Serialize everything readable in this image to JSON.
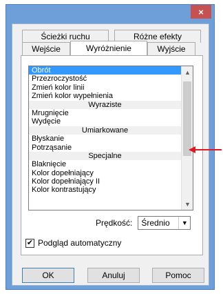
{
  "window": {
    "close_glyph": "×"
  },
  "tabs_back": [
    "Ścieżki ruchu",
    "Różne efekty"
  ],
  "tabs_front": [
    "Wejście",
    "Wyróżnienie",
    "Wyjście"
  ],
  "selected_tab": "Wyróżnienie",
  "list": [
    {
      "type": "item",
      "label": "Obrót",
      "selected": true
    },
    {
      "type": "item",
      "label": "Przezroczystość"
    },
    {
      "type": "item",
      "label": "Zmień kolor linii"
    },
    {
      "type": "item",
      "label": "Zmień kolor wypełnienia"
    },
    {
      "type": "header",
      "label": "Wyraziste"
    },
    {
      "type": "item",
      "label": "Mrugnięcie"
    },
    {
      "type": "item",
      "label": "Wydęcie"
    },
    {
      "type": "header",
      "label": "Umiarkowane"
    },
    {
      "type": "item",
      "label": "Błyskanie"
    },
    {
      "type": "item",
      "label": "Potrząsanie"
    },
    {
      "type": "header",
      "label": "Specjalne"
    },
    {
      "type": "item",
      "label": "Blaknięcie"
    },
    {
      "type": "item",
      "label": "Kolor dopełniający"
    },
    {
      "type": "item",
      "label": "Kolor dopełniający II"
    },
    {
      "type": "item",
      "label": "Kolor kontrastujący"
    }
  ],
  "speed": {
    "label": "Prędkość:",
    "value": "Średnio"
  },
  "preview": {
    "label": "Podgląd automatyczny",
    "checked": true
  },
  "buttons": {
    "ok": "OK",
    "cancel": "Anuluj",
    "help": "Pomoc"
  },
  "colors": {
    "frame": "#6e9fd8",
    "close": "#c75050",
    "selection": "#3399ff",
    "annotation": "#e0191f"
  }
}
